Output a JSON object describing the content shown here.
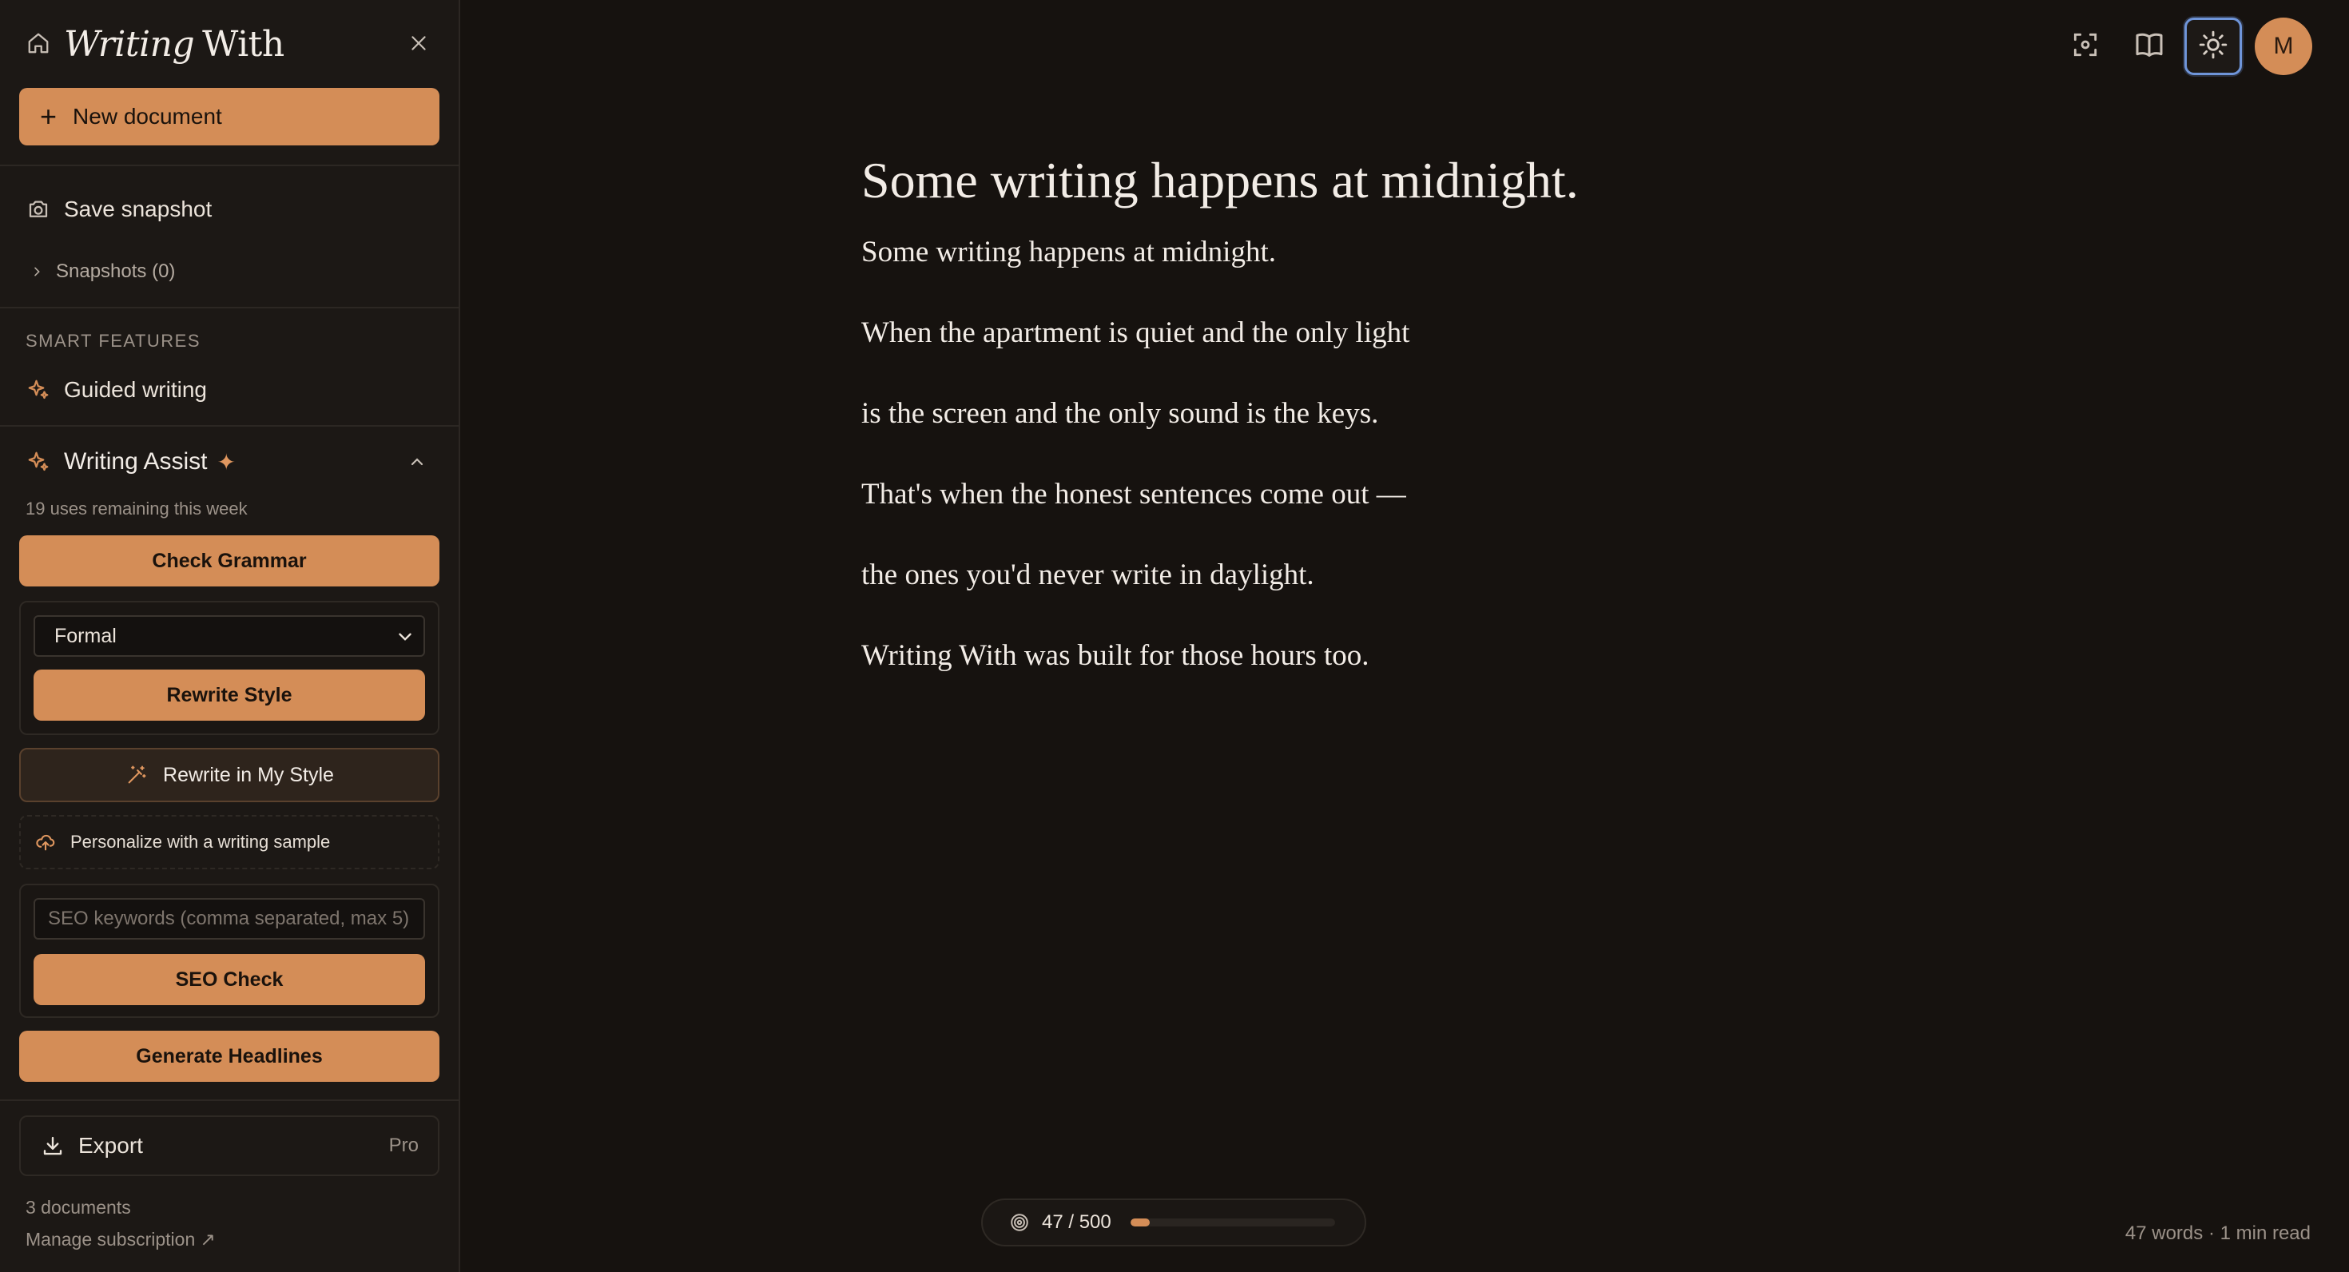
{
  "sidebar": {
    "brand_italic": "Writing",
    "brand_regular": "With",
    "new_document_label": "New document",
    "save_snapshot_label": "Save snapshot",
    "snapshots_label": "Snapshots (0)",
    "smart_features_label": "SMART FEATURES",
    "guided_writing_label": "Guided writing",
    "writing_assist": {
      "title": "Writing Assist",
      "sparkle": "✦",
      "uses_remaining": "19 uses remaining this week",
      "check_grammar_label": "Check Grammar",
      "style_selected": "Formal",
      "rewrite_style_label": "Rewrite Style",
      "rewrite_my_style_label": "Rewrite in My Style",
      "personalize_label": "Personalize with a writing sample",
      "seo_placeholder": "SEO keywords (comma separated, max 5)",
      "seo_check_label": "SEO Check",
      "generate_headlines_label": "Generate Headlines"
    },
    "export_label": "Export",
    "export_badge": "Pro",
    "documents_count": "3 documents",
    "manage_subscription": "Manage subscription ↗"
  },
  "toolbar": {
    "icons": [
      "focus-icon",
      "reading-icon",
      "theme-icon"
    ],
    "avatar_initial": "M"
  },
  "document": {
    "title": "Some writing happens at midnight.",
    "paragraphs": [
      "Some writing happens at midnight.",
      "When the apartment is quiet and the only light",
      "is the screen and the only sound is the keys.",
      "That's when the honest sentences come out —",
      "the ones you'd never write in daylight.",
      "Writing With was built for those hours too."
    ]
  },
  "status": {
    "goal_text": "47 / 500",
    "goal_current": 47,
    "goal_target": 500,
    "word_stats": "47 words · 1 min read"
  },
  "colors": {
    "accent": "#d48d57",
    "background": "#16120f",
    "sidebar": "#1c1815",
    "active_outline": "#6f95d9"
  }
}
